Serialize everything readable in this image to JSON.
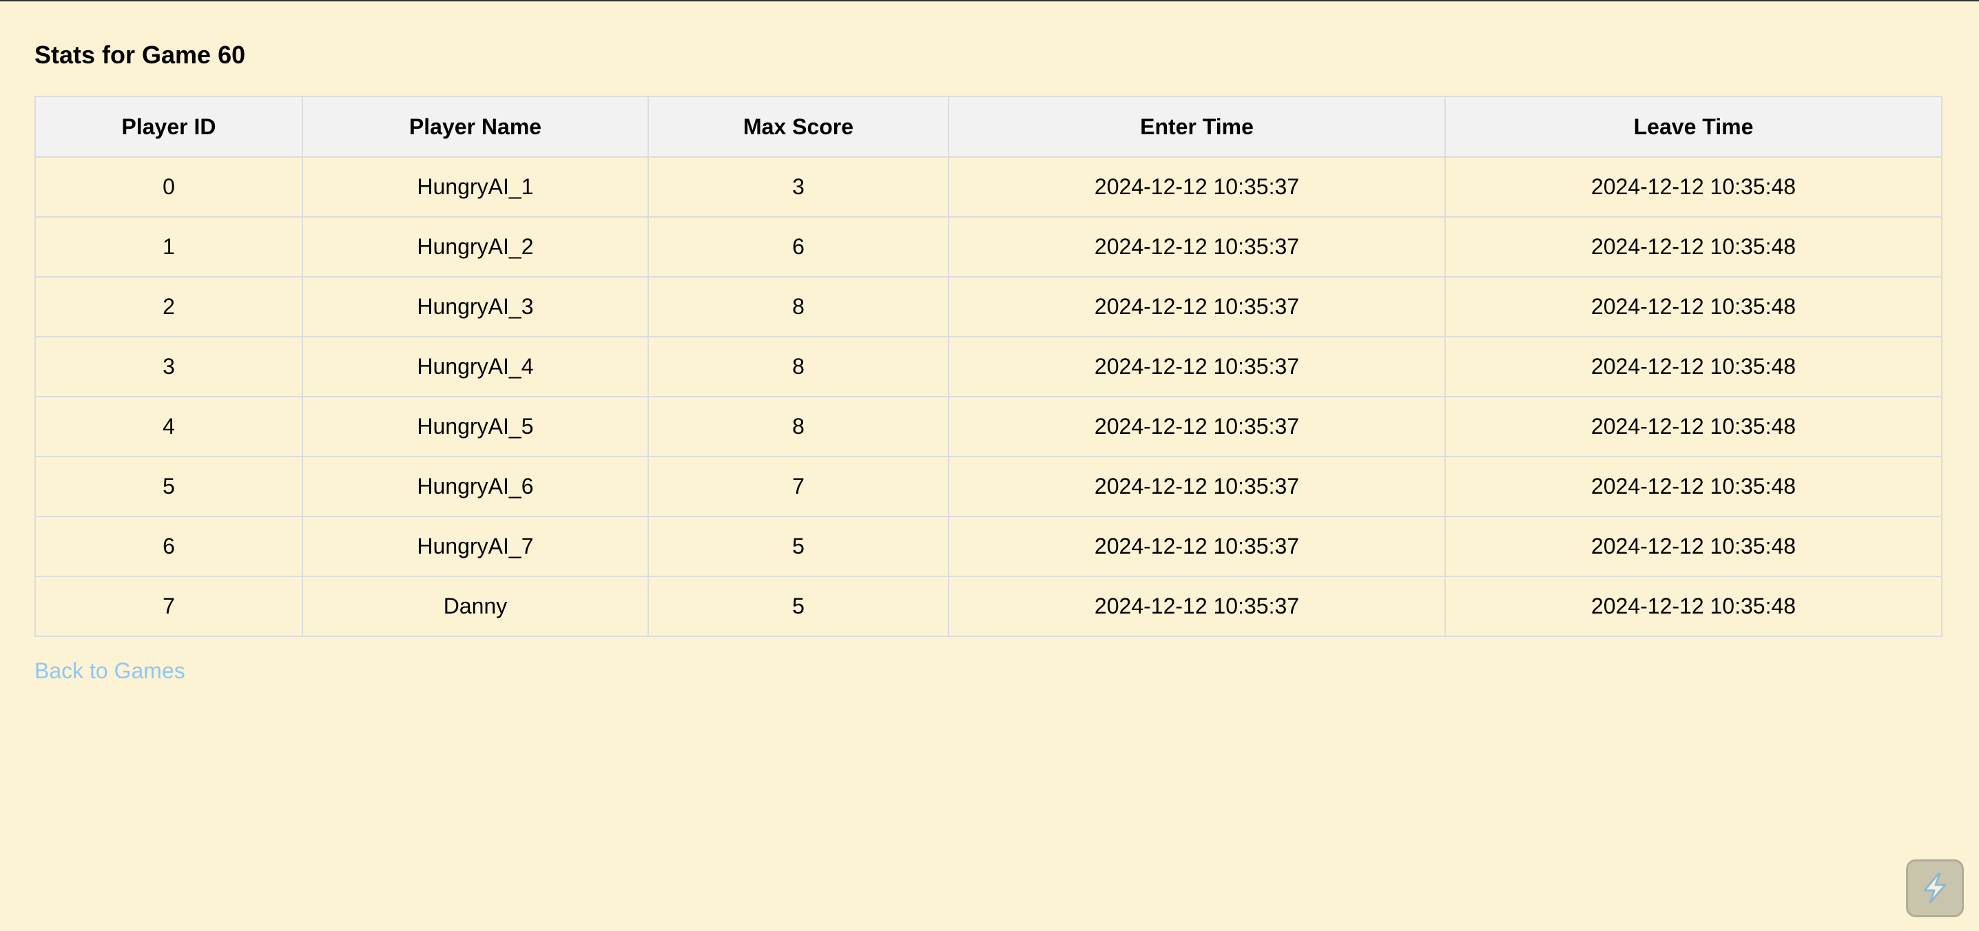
{
  "page": {
    "title": "Stats for Game 60",
    "back_link": "Back to Games"
  },
  "table": {
    "headers": [
      "Player ID",
      "Player Name",
      "Max Score",
      "Enter Time",
      "Leave Time"
    ],
    "rows": [
      [
        "0",
        "HungryAI_1",
        "3",
        "2024-12-12 10:35:37",
        "2024-12-12 10:35:48"
      ],
      [
        "1",
        "HungryAI_2",
        "6",
        "2024-12-12 10:35:37",
        "2024-12-12 10:35:48"
      ],
      [
        "2",
        "HungryAI_3",
        "8",
        "2024-12-12 10:35:37",
        "2024-12-12 10:35:48"
      ],
      [
        "3",
        "HungryAI_4",
        "8",
        "2024-12-12 10:35:37",
        "2024-12-12 10:35:48"
      ],
      [
        "4",
        "HungryAI_5",
        "8",
        "2024-12-12 10:35:37",
        "2024-12-12 10:35:48"
      ],
      [
        "5",
        "HungryAI_6",
        "7",
        "2024-12-12 10:35:37",
        "2024-12-12 10:35:48"
      ],
      [
        "6",
        "HungryAI_7",
        "5",
        "2024-12-12 10:35:37",
        "2024-12-12 10:35:48"
      ],
      [
        "7",
        "Danny",
        "5",
        "2024-12-12 10:35:37",
        "2024-12-12 10:35:48"
      ]
    ]
  },
  "widget": {
    "icon": "lightning-bolt-icon"
  },
  "colors": {
    "background": "#fcf3d5",
    "header_background": "#f2f2f2",
    "border": "#dcdcdc",
    "link": "#8cc8f5"
  }
}
